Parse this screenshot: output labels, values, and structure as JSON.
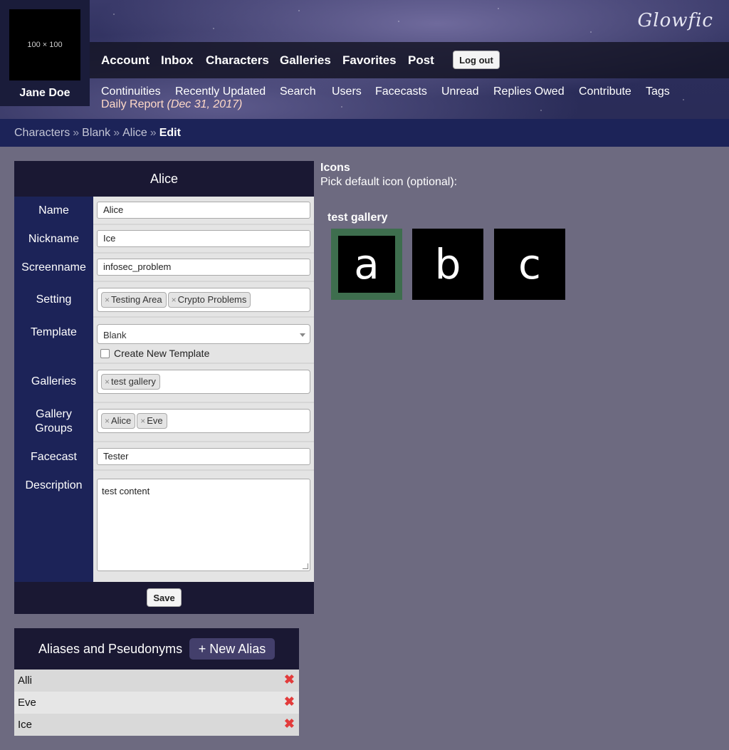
{
  "header": {
    "avatar_placeholder": "100 × 100",
    "username": "Jane Doe",
    "logo": "Glowfic",
    "nav": [
      "Account",
      "Inbox",
      "Characters",
      "Galleries",
      "Favorites",
      "Post"
    ],
    "logout_label": "Log out",
    "subnav": [
      "Continuities",
      "Recently Updated",
      "Search",
      "Users",
      "Facecasts",
      "Unread",
      "Replies Owed",
      "Contribute",
      "Tags"
    ],
    "daily_report_label": "Daily Report",
    "daily_report_date": "(Dec 31, 2017)"
  },
  "breadcrumb": {
    "items": [
      "Characters",
      "Blank",
      "Alice"
    ],
    "separator": "»",
    "current": "Edit"
  },
  "form": {
    "title": "Alice",
    "labels": {
      "name": "Name",
      "nickname": "Nickname",
      "screenname": "Screenname",
      "setting": "Setting",
      "template": "Template",
      "galleries": "Galleries",
      "gallery_groups_1": "Gallery",
      "gallery_groups_2": "Groups",
      "facecast": "Facecast",
      "description": "Description"
    },
    "values": {
      "name": "Alice",
      "nickname": "Ice",
      "screenname": "infosec_problem",
      "settings": [
        "Testing Area",
        "Crypto Problems"
      ],
      "template": "Blank",
      "create_new_template_label": "Create New Template",
      "create_new_template_checked": false,
      "galleries": [
        "test gallery"
      ],
      "gallery_groups": [
        "Alice",
        "Eve"
      ],
      "facecast": "Tester",
      "description": "test content"
    },
    "tag_remove_glyph": "×",
    "save_label": "Save"
  },
  "aliases": {
    "title": "Aliases and Pseudonyms",
    "new_alias_label": "+ New Alias",
    "items": [
      "Alli",
      "Eve",
      "Ice"
    ],
    "delete_glyph": "✖"
  },
  "icons": {
    "heading": "Icons",
    "hint": "Pick default icon (optional):",
    "gallery_name": "test gallery",
    "tiles": [
      "a",
      "b",
      "c"
    ],
    "selected_index": 0
  },
  "colors": {
    "page_bg": "#6d6a80",
    "panel_dark": "#1a1833",
    "label_blue": "#1c2358",
    "selected_icon_border": "#3e6e4e",
    "delete_red": "#e23b3b"
  }
}
